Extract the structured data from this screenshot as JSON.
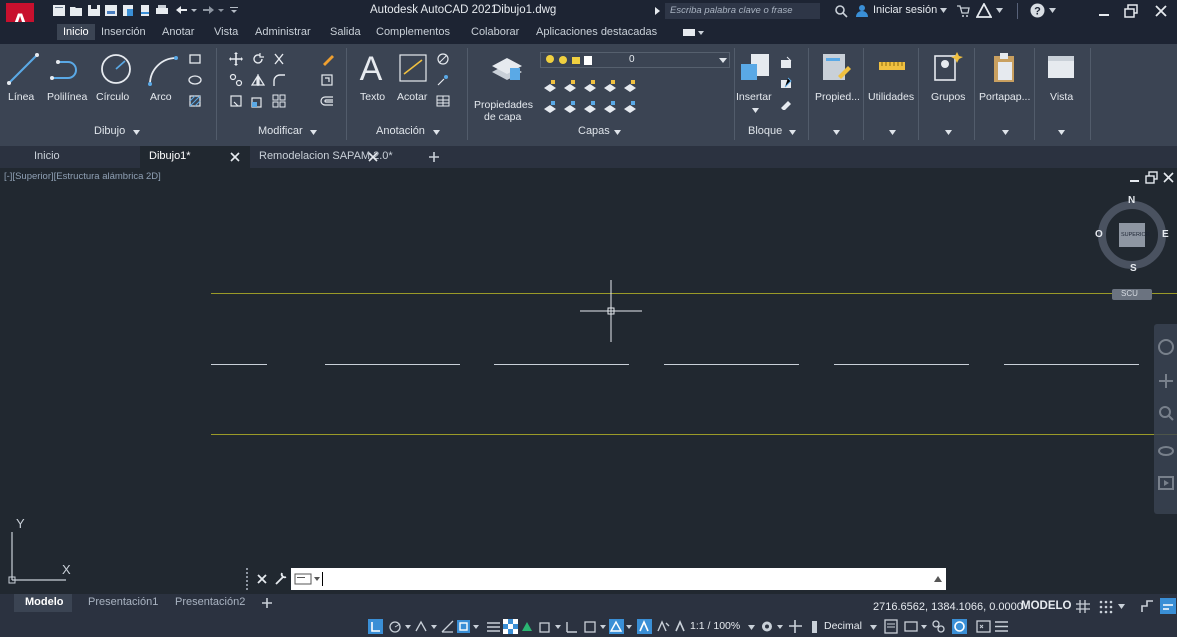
{
  "titlebar": {
    "app_title": "Autodesk AutoCAD 2021",
    "doc_name": "Dibujo1.dwg",
    "search_placeholder": "Escriba palabra clave o frase",
    "signin": "Iniciar sesión"
  },
  "ribbon_tabs": [
    "Inicio",
    "Inserción",
    "Anotar",
    "Vista",
    "Administrar",
    "Salida",
    "Complementos",
    "Colaborar",
    "Aplicaciones destacadas"
  ],
  "ribbon": {
    "draw": {
      "line": "Línea",
      "polyline": "Polilínea",
      "circle": "Círculo",
      "arc": "Arco",
      "panel": "Dibujo"
    },
    "modify": {
      "panel": "Modificar"
    },
    "annotation": {
      "text": "Texto",
      "dimension": "Acotar",
      "panel": "Anotación"
    },
    "layers": {
      "props_line1": "Propiedades",
      "props_line2": "de capa",
      "current_layer": "0",
      "panel": "Capas"
    },
    "block": {
      "insert": "Insertar",
      "panel": "Bloque"
    },
    "properties": "Propied...",
    "utilities": "Utilidades",
    "groups": "Grupos",
    "clipboard": "Portapap...",
    "view": "Vista"
  },
  "doc_tabs": {
    "start": "Inicio",
    "active": "Dibujo1*",
    "other": "Remodelacion SAPAM 2.0*"
  },
  "viewport": {
    "label": "[-][Superior][Estructura alámbrica 2D]",
    "viewcube": {
      "north": "N",
      "south": "S",
      "east": "E",
      "west": "O",
      "face": "SUPERIOR",
      "ucs": "SCU"
    },
    "ucs_x": "X",
    "ucs_y": "Y"
  },
  "layout_tabs": [
    "Modelo",
    "Presentación1",
    "Presentación2"
  ],
  "status": {
    "coordinates": "2716.6562, 1384.1066, 0.0000",
    "mode": "MODELO",
    "scale": "1:1 / 100%",
    "units": "Decimal"
  },
  "colors": {
    "accent_red": "#c8102e",
    "title_bg": "#1d2433",
    "ribbon_bg": "#3b4453",
    "canvas_bg": "#212830",
    "yellow_line": "#9a9a28",
    "highlight_blue": "#3a8fd6"
  }
}
